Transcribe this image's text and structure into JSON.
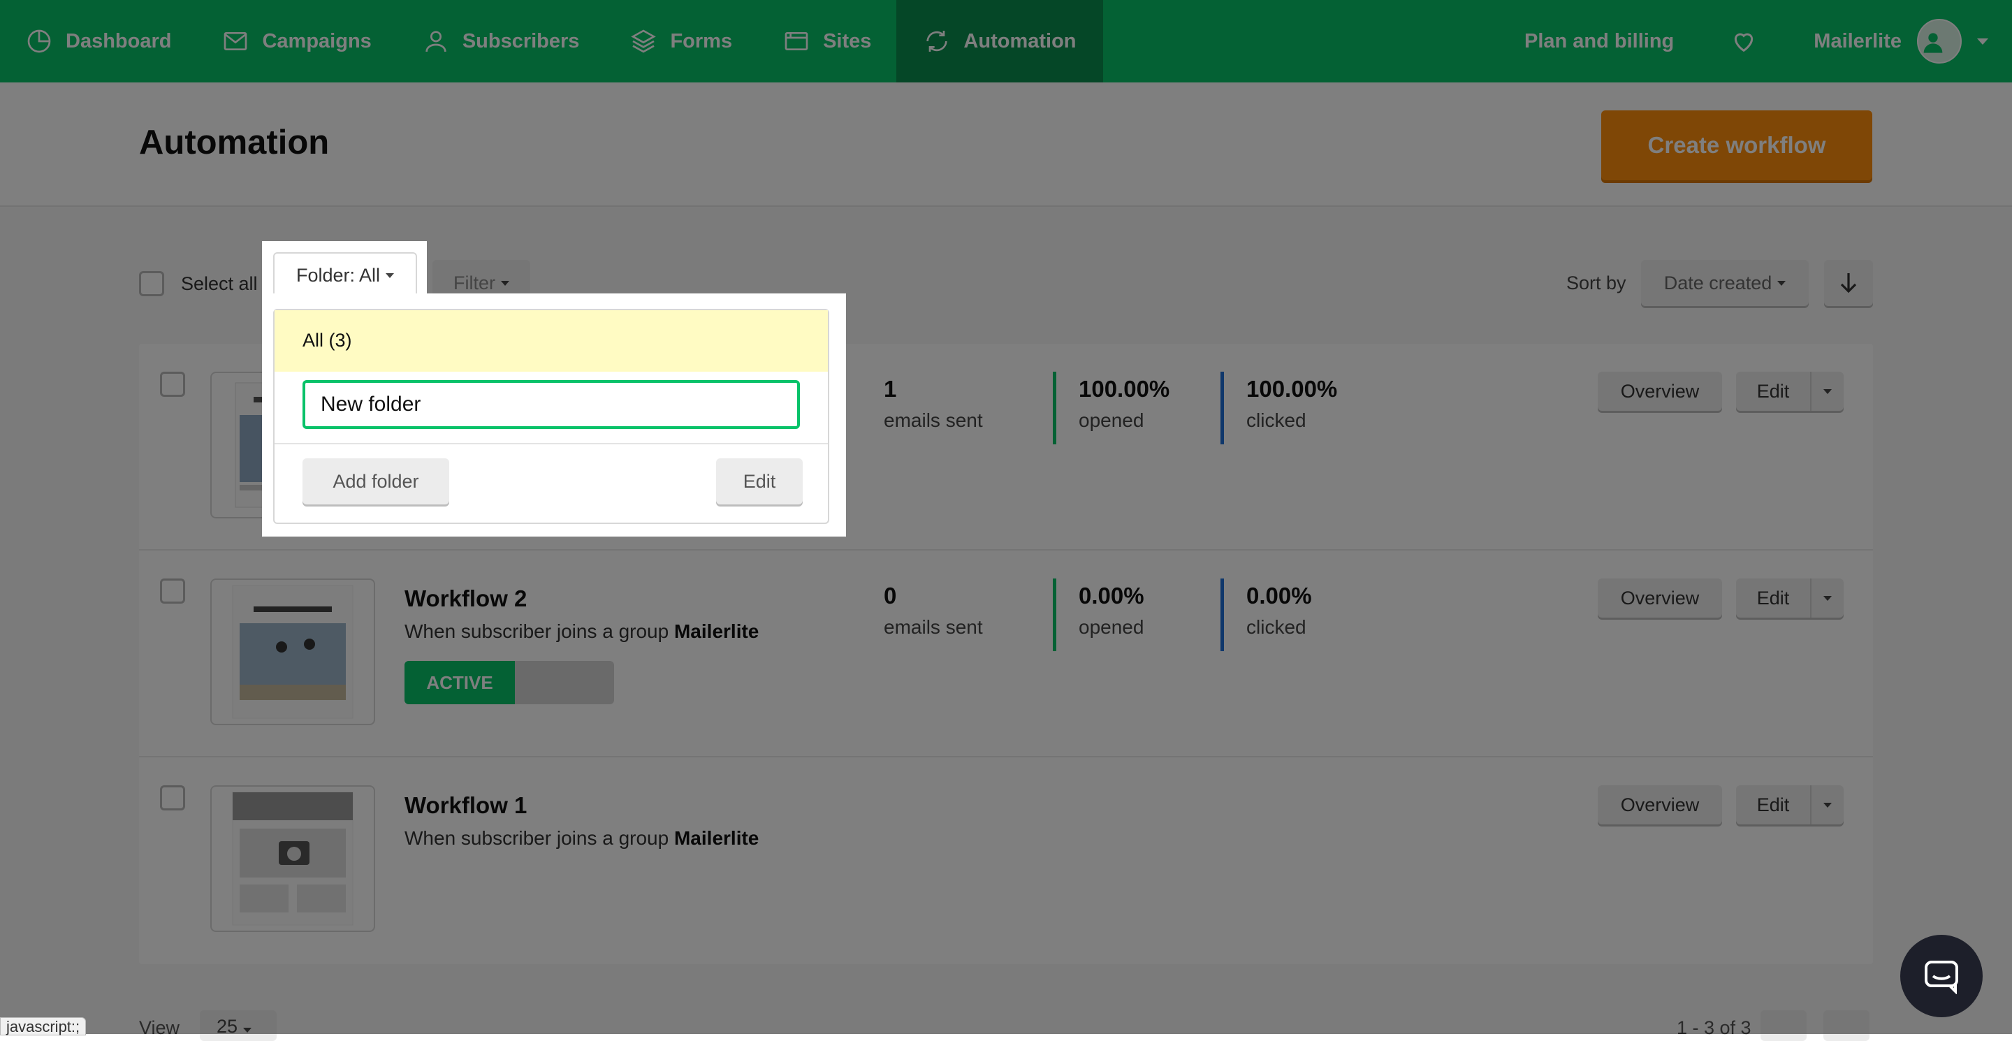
{
  "nav": {
    "items": [
      {
        "label": "Dashboard",
        "icon": "dashboard-icon"
      },
      {
        "label": "Campaigns",
        "icon": "mail-icon"
      },
      {
        "label": "Subscribers",
        "icon": "user-icon"
      },
      {
        "label": "Forms",
        "icon": "layers-icon"
      },
      {
        "label": "Sites",
        "icon": "browser-icon"
      },
      {
        "label": "Automation",
        "icon": "refresh-icon",
        "active": true
      }
    ],
    "plan_billing": "Plan and billing",
    "account_name": "Mailerlite"
  },
  "header": {
    "title": "Automation",
    "create_button": "Create workflow"
  },
  "toolbar": {
    "select_all": "Select all",
    "folder_button": "Folder: All",
    "filter_button": "Filter",
    "sort_by_label": "Sort by",
    "sort_value": "Date created"
  },
  "folder_dropdown": {
    "all_item": "All (3)",
    "new_folder_value": "New folder",
    "add_folder_button": "Add folder",
    "edit_button": "Edit"
  },
  "workflows": [
    {
      "name": "",
      "trigger_text": "",
      "trigger_group": "",
      "emails_sent": "1",
      "emails_sent_label": "emails sent",
      "opened": "100.00%",
      "opened_label": "opened",
      "clicked": "100.00%",
      "clicked_label": "clicked",
      "overview": "Overview",
      "edit": "Edit"
    },
    {
      "name": "Workflow 2",
      "trigger_text": "When subscriber joins a group ",
      "trigger_group": "Mailerlite",
      "status": "ACTIVE",
      "emails_sent": "0",
      "emails_sent_label": "emails sent",
      "opened": "0.00%",
      "opened_label": "opened",
      "clicked": "0.00%",
      "clicked_label": "clicked",
      "overview": "Overview",
      "edit": "Edit"
    },
    {
      "name": "Workflow 1",
      "trigger_text": "When subscriber joins a group ",
      "trigger_group": "Mailerlite",
      "overview": "Overview",
      "edit": "Edit"
    }
  ],
  "footer": {
    "view_label": "View",
    "per_page": "25",
    "range": "1 - 3 of 3"
  },
  "status_bar": "javascript:;",
  "colors": {
    "brand_green": "#09c269",
    "create_orange": "#ff8e0c",
    "clicked_blue": "#1f6fd6",
    "highlight_yellow": "#fffbc3"
  }
}
